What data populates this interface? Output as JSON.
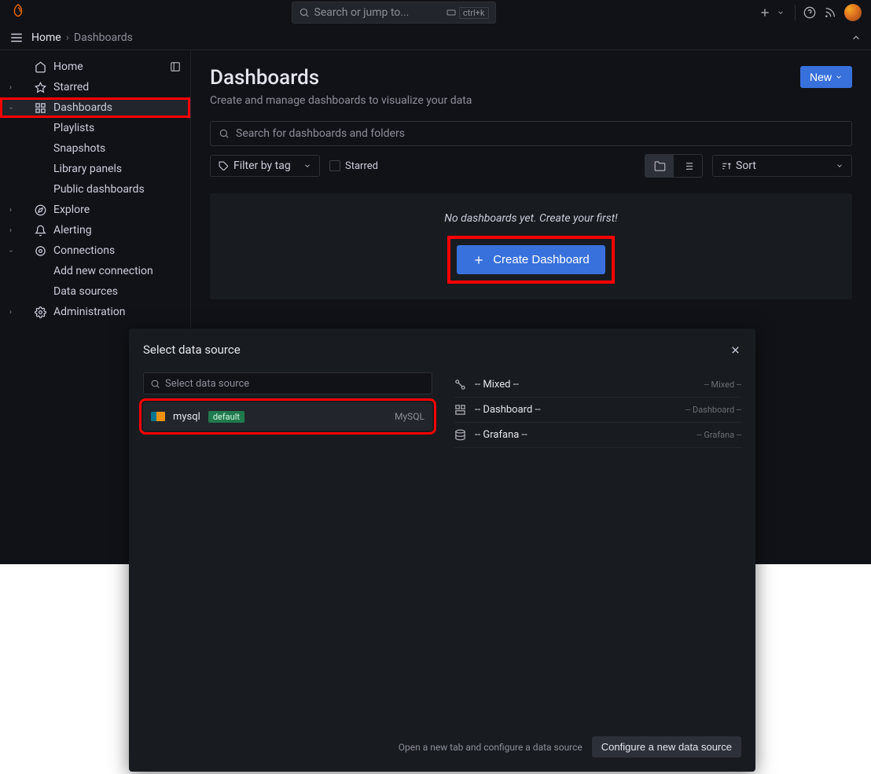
{
  "topbar": {
    "search_placeholder": "Search or jump to...",
    "kbd_hint": "ctrl+k"
  },
  "breadcrumb": {
    "home": "Home",
    "current": "Dashboards"
  },
  "sidebar": {
    "home": "Home",
    "starred": "Starred",
    "dashboards": "Dashboards",
    "playlists": "Playlists",
    "snapshots": "Snapshots",
    "library_panels": "Library panels",
    "public_dashboards": "Public dashboards",
    "explore": "Explore",
    "alerting": "Alerting",
    "connections": "Connections",
    "add_connection": "Add new connection",
    "data_sources": "Data sources",
    "administration": "Administration"
  },
  "page": {
    "title": "Dashboards",
    "subtitle": "Create and manage dashboards to visualize your data",
    "new_btn": "New",
    "search_placeholder": "Search for dashboards and folders",
    "filter_tag": "Filter by tag",
    "starred_label": "Starred",
    "sort_label": "Sort",
    "empty_text": "No dashboards yet. Create your first!",
    "create_btn": "Create Dashboard"
  },
  "modal": {
    "title": "Select data source",
    "search_placeholder": "Select data source",
    "ds": {
      "name": "mysql",
      "badge": "default",
      "type": "MySQL"
    },
    "builtin": [
      {
        "label": "-- Mixed --",
        "right": "-- Mixed --"
      },
      {
        "label": "-- Dashboard --",
        "right": "-- Dashboard --"
      },
      {
        "label": "-- Grafana --",
        "right": "-- Grafana --"
      }
    ],
    "foot_text": "Open a new tab and configure a data source",
    "foot_btn": "Configure a new data source"
  }
}
